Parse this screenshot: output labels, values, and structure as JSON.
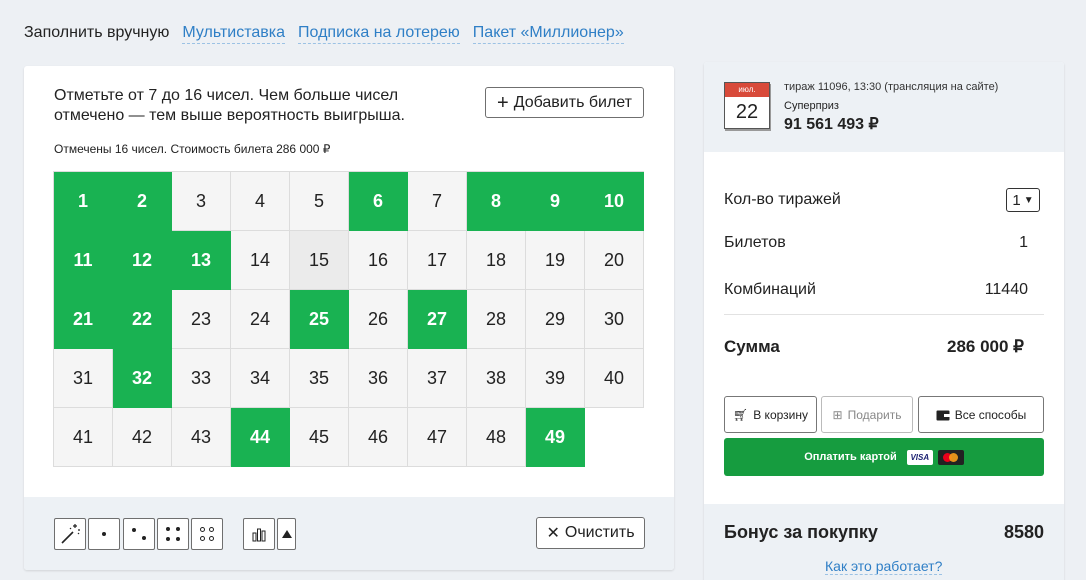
{
  "tabs": [
    {
      "label": "Заполнить вручную",
      "active": true
    },
    {
      "label": "Мультиставка",
      "active": false
    },
    {
      "label": "Подписка на лотерею",
      "active": false
    },
    {
      "label": "Пакет «Миллионер»",
      "active": false
    }
  ],
  "ticket": {
    "instruction": "Отметьте от 7 до 16 чисел. Чем больше чисел отмечено — тем выше вероятность выигрыша.",
    "add_button": "Добавить билет",
    "status": "Отмечены 16 чисел. Стоимость билета 286 000 ₽",
    "numbers": [
      1,
      2,
      3,
      4,
      5,
      6,
      7,
      8,
      9,
      10,
      11,
      12,
      13,
      14,
      15,
      16,
      17,
      18,
      19,
      20,
      21,
      22,
      23,
      24,
      25,
      26,
      27,
      28,
      29,
      30,
      31,
      32,
      33,
      34,
      35,
      36,
      37,
      38,
      39,
      40,
      41,
      42,
      43,
      44,
      45,
      46,
      47,
      48,
      49
    ],
    "selected": [
      1,
      2,
      6,
      8,
      9,
      10,
      11,
      12,
      13,
      21,
      22,
      25,
      27,
      32,
      44,
      49
    ],
    "hovered": 15,
    "clear_button": "Очистить"
  },
  "tools": [
    {
      "name": "magic-wand-icon"
    },
    {
      "name": "one-dot-icon"
    },
    {
      "name": "two-dots-icon"
    },
    {
      "name": "four-dots-icon"
    },
    {
      "name": "four-circles-icon"
    },
    {
      "name": "bar-chart-icon"
    },
    {
      "name": "triangle-up-icon"
    }
  ],
  "draw": {
    "month": "июл.",
    "day": "22",
    "info": "тираж 11096, 13:30 (трансляция на сайте)",
    "superprize_label": "Суперприз",
    "superprize_value": "91 561 493 ₽"
  },
  "order": {
    "draws_label": "Кол-во тиражей",
    "draws_value": "1",
    "tickets_label": "Билетов",
    "tickets_value": "1",
    "combinations_label": "Комбинаций",
    "combinations_value": "11440",
    "sum_label": "Сумма",
    "sum_value": "286 000 ₽"
  },
  "actions": {
    "cart": "В корзину",
    "gift": "Подарить",
    "all_methods": "Все способы",
    "pay_card": "Оплатить картой",
    "visa": "VISA"
  },
  "bonus": {
    "label": "Бонус за покупку",
    "value": "8580",
    "how_link": "Как это работает?"
  },
  "colors": {
    "selected_cell": "#19b252",
    "pay_button": "#169c3f",
    "link": "#2f7fc6",
    "calendar_red": "#d84a3a"
  }
}
